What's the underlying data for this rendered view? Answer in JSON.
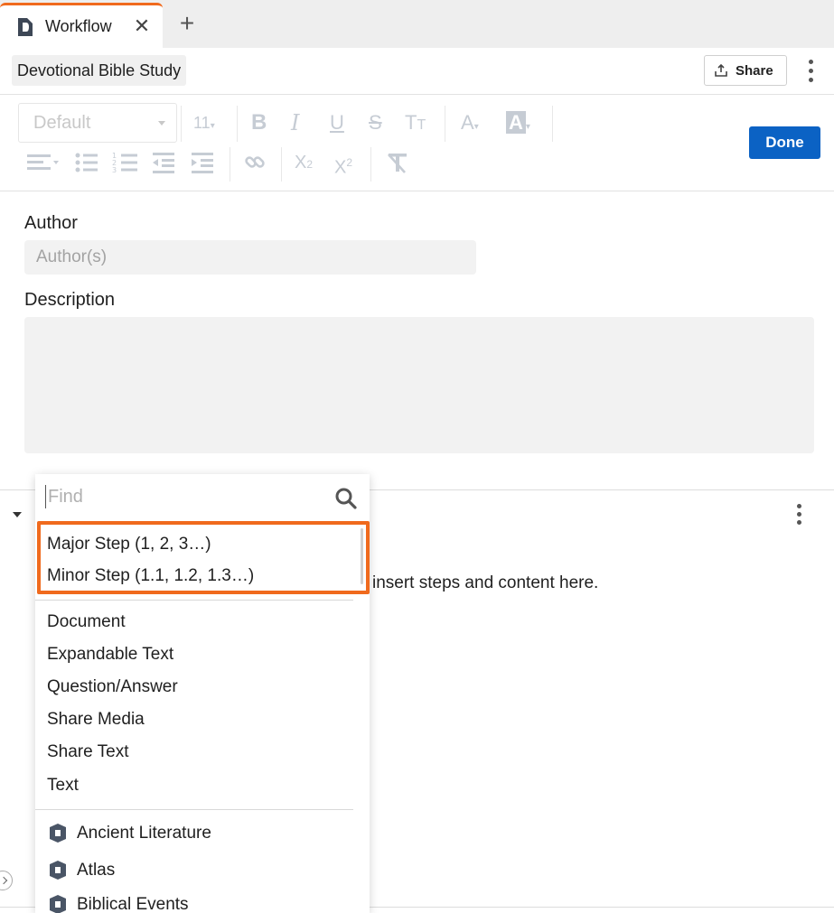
{
  "tabs": [
    {
      "label": "Workflow",
      "icon": "document-logo-icon"
    }
  ],
  "header": {
    "doc_title": "Devotional Bible Study",
    "share_label": "Share"
  },
  "toolbar": {
    "font_family": "Default",
    "font_size": "11",
    "done_label": "Done"
  },
  "form": {
    "author_label": "Author",
    "author_placeholder": "Author(s)",
    "description_label": "Description"
  },
  "content": {
    "hint_text": "insert steps and content here."
  },
  "dropdown": {
    "find_placeholder": "Find",
    "steps": [
      "Major Step (1, 2, 3…)",
      "Minor Step (1.1, 1.2, 1.3…)"
    ],
    "items": [
      "Document",
      "Expandable Text",
      "Question/Answer",
      "Share Media",
      "Share Text",
      "Text"
    ],
    "resources": [
      "Ancient Literature",
      "Atlas",
      "Biblical Events"
    ]
  },
  "colors": {
    "accent_orange": "#f06a1d",
    "primary_blue": "#0b62c4"
  }
}
